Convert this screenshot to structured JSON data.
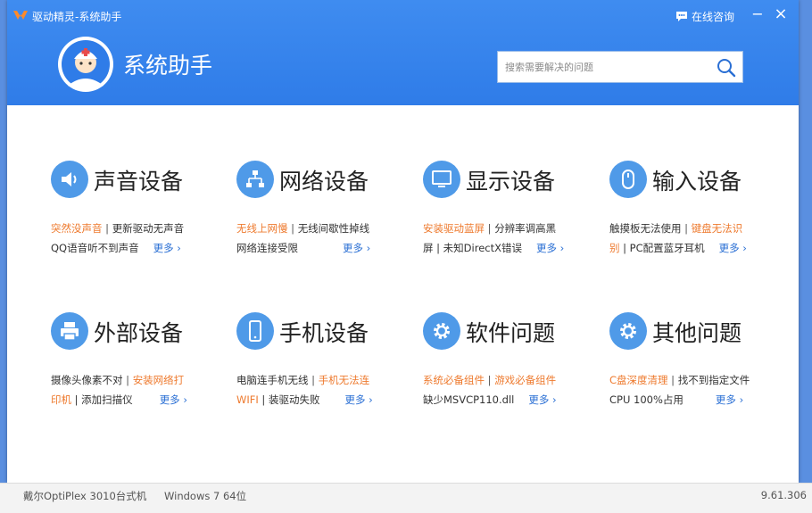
{
  "window": {
    "title": "驱动精灵-系统助手",
    "consult_label": "在线咨询",
    "minimize_symbol": "−",
    "close_symbol": "×"
  },
  "header": {
    "app_name": "系统助手",
    "search_placeholder": "搜索需要解决的问题"
  },
  "categories": [
    {
      "title": "声音设备",
      "icon": "speaker-icon",
      "line1": [
        {
          "text": "突然没声音",
          "hot": true
        },
        {
          "text": " | ",
          "hot": false
        },
        {
          "text": "更新驱动无声音",
          "hot": false
        }
      ],
      "line2": [
        {
          "text": "QQ语音听不到声音",
          "hot": false
        }
      ],
      "more": "更多"
    },
    {
      "title": "网络设备",
      "icon": "network-icon",
      "line1": [
        {
          "text": "无线上网慢",
          "hot": true
        },
        {
          "text": " | ",
          "hot": false
        },
        {
          "text": "无线间歇性掉线",
          "hot": false
        }
      ],
      "line2": [
        {
          "text": "网络连接受限",
          "hot": false
        }
      ],
      "more": "更多"
    },
    {
      "title": "显示设备",
      "icon": "monitor-icon",
      "line1": [
        {
          "text": "安装驱动蓝屏",
          "hot": true
        },
        {
          "text": " | ",
          "hot": false
        },
        {
          "text": "分辨率调高黑",
          "hot": false
        }
      ],
      "line2": [
        {
          "text": "屏 | 未知DirectX错误",
          "hot": false
        }
      ],
      "more": "更多"
    },
    {
      "title": "输入设备",
      "icon": "mouse-icon",
      "line1": [
        {
          "text": "触摸板无法使用",
          "hot": false
        },
        {
          "text": " | ",
          "hot": false
        },
        {
          "text": "键盘无法识",
          "hot": true
        }
      ],
      "line2": [
        {
          "text": "别",
          "hot": true
        },
        {
          "text": " | PC配置蓝牙耳机",
          "hot": false
        }
      ],
      "more": "更多"
    },
    {
      "title": "外部设备",
      "icon": "printer-icon",
      "line1": [
        {
          "text": "摄像头像素不对",
          "hot": false
        },
        {
          "text": " | ",
          "hot": false
        },
        {
          "text": "安装网络打",
          "hot": true
        }
      ],
      "line2": [
        {
          "text": "印机",
          "hot": true
        },
        {
          "text": " | 添加扫描仪",
          "hot": false
        }
      ],
      "more": "更多"
    },
    {
      "title": "手机设备",
      "icon": "phone-icon",
      "line1": [
        {
          "text": "电脑连手机无线",
          "hot": false
        },
        {
          "text": " | ",
          "hot": false
        },
        {
          "text": "手机无法连",
          "hot": true
        }
      ],
      "line2": [
        {
          "text": "WIFI",
          "hot": true
        },
        {
          "text": " | 装驱动失败",
          "hot": false
        }
      ],
      "more": "更多"
    },
    {
      "title": "软件问题",
      "icon": "gear-icon",
      "line1": [
        {
          "text": "系统必备组件",
          "hot": true
        },
        {
          "text": " | ",
          "hot": false
        },
        {
          "text": "游戏必备组件",
          "hot": true
        }
      ],
      "line2": [
        {
          "text": "缺少MSVCP110.dll",
          "hot": false
        }
      ],
      "more": "更多"
    },
    {
      "title": "其他问题",
      "icon": "gear-icon",
      "line1": [
        {
          "text": "C盘深度清理",
          "hot": true
        },
        {
          "text": " | ",
          "hot": false
        },
        {
          "text": "找不到指定文件",
          "hot": false
        }
      ],
      "line2": [
        {
          "text": "CPU 100%占用",
          "hot": false
        }
      ],
      "more": "更多"
    }
  ],
  "status": {
    "model": "戴尔OptiPlex 3010台式机",
    "os": "Windows 7 64位",
    "version": "9.61.306"
  },
  "colors": {
    "header_blue": "#2f7ce8",
    "icon_blue": "#4f9ae8",
    "hot_orange": "#ee7a2e",
    "link_blue": "#2a6fd4"
  }
}
